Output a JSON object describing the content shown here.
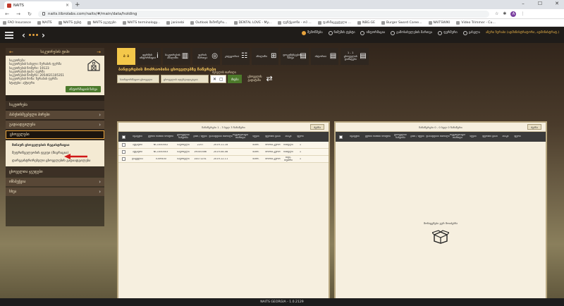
{
  "browser": {
    "tab_title": "NAITS",
    "url": "naits.tibrolabs.com/naits/#/main/data/holding",
    "bookmarks": [
      "FAO Insurance",
      "NAITS",
      "NAITS ტესტ",
      "NAITS ჯგუფები",
      "NAITS terminology...",
      "janinebi",
      "Outlook მიმოწერა...",
      "DENTAL LOVE - My...",
      "ფუნქციონი - ოპ ...",
      "ფარმაცევტული ...",
      "NBG.GE",
      "Burger Sword Caree...",
      "NAITSWIKI",
      "Video Trimmer - Cu..."
    ],
    "profile_initial": "A"
  },
  "topnav": {
    "items": [
      "შემოწმება",
      "ნიმუშის ტესტი",
      "ინფორმაცია",
      "გამოსახულების მართვა",
      "ფერმერი",
      "გასვლა"
    ],
    "user": "აზერი ზურაბი (ადმინისტრატორი, ადმინისტრატ.)",
    "languages": [
      "KA",
      "EN"
    ]
  },
  "left": {
    "header": "საკუთრების ტიპი",
    "farm_lines": [
      "საკუთრება:",
      "საკუთრების სახელი: ზურაბის ფერმა",
      "საკუთრების ნომერი: 19123",
      "საკუთრების ტიპი: ფერმა",
      "საკუთრების ნომერი: 2054021105351",
      "საკუთრების ზონა: ზურაბის ფერმა",
      "სტატუსი: აქტიური"
    ],
    "farm_button": "ინფორმაციის ნახვა",
    "menu": [
      {
        "label": "საკუთრება",
        "arrow": "",
        "style": "dark"
      },
      {
        "label": "პასუხისმგებელი პირები",
        "arrow": "›",
        "style": "light"
      },
      {
        "label": "გადაადგილება",
        "arrow": "›",
        "style": "light"
      },
      {
        "label": "ცხოველები",
        "arrow": "",
        "style": "active"
      }
    ],
    "submenu": [
      "შინაურ ცხოველების რეგისტრაცია",
      "მეფრინველეობის ჯგუფი (მიგრაცია)",
      "დარეგისტრირებული ცხოველების გადაადგილება"
    ],
    "menu2": [
      {
        "label": "ცხოველთა ჯგუფები",
        "arrow": "",
        "style": "dark"
      },
      {
        "label": "ინსპექცია",
        "arrow": "›",
        "style": "light"
      },
      {
        "label": "სხვა",
        "arrow": "›",
        "style": "light"
      }
    ]
  },
  "toolbar": {
    "first": "ა ა",
    "buttons": [
      {
        "label": "ფერმის ინფორმაცია",
        "icon": "i"
      },
      {
        "label": "საკუთრების ანალიზი",
        "icon": "▥"
      },
      {
        "label": "ფარის მართვა",
        "icon": "◎"
      },
      {
        "label": "კატეგორია",
        "icon": "☷"
      },
      {
        "label": "ანალიზი",
        "icon": "⊞"
      },
      {
        "label": "დოკუმენტების ნახვა",
        "icon": "▤"
      },
      {
        "label": "ისტორია",
        "icon": "▤"
      },
      {
        "label": "1 - 1 ცხოველის დამატება",
        "icon": "▤"
      }
    ]
  },
  "page": {
    "title": "ბანდერების მოძრაობისა ცხოველებზე ჩაწერები",
    "filter1": "საინფორმაციო ცხოველი",
    "filter2": "ცხოველის იდენტიფიკაცია",
    "date_label": "შესვლის თარიღი",
    "search_label": "ძიება",
    "move_label": "ცხოველის გადატანა"
  },
  "grid_left": {
    "caption": "ჩანაწერები 1 - 3 სულ 3 ჩანაწერი",
    "button": "ძებნა",
    "columns": [
      "სტატუსი",
      "ყურის ნიშნის ნომერი",
      "ცხოველის სახეობა",
      "ჯიში / სქესი",
      "დაბადების თარიღი",
      "რეგისტრაციის თარიღი",
      "სქესი",
      "ფერმის ტიპი",
      "ასაკი",
      "ფერი"
    ],
    "rows": [
      [
        "აქტიური",
        "NC1000002",
        "საქონელი",
        "2257",
        "2019-11-18",
        "მამრ.",
        "ძროხა-კურო",
        "წითელი",
        "1"
      ],
      [
        "აქტიური",
        "NC1000003",
        "საქონელი",
        "19005386",
        "2019-08-08",
        "მამრ.",
        "ძროხა-კურო",
        "წითელი",
        "1"
      ],
      [
        "დაცულია",
        "TU09400",
        "საქონელი",
        "14471251",
        "2019-12-11",
        "მამრ.",
        "ძროხა-კურო",
        "შავი-თეთრი",
        "1"
      ]
    ]
  },
  "grid_right": {
    "caption": "ჩანაწერები 0 - 0 სულ 0 ჩანაწერი",
    "button": "ძებნა",
    "columns": [
      "სტატუსი",
      "ყურის ნიშნის ნომერი",
      "ცხოველის სახეობა",
      "ჯიში / სქესი",
      "დაბადების თარიღი",
      "რეგისტრაციის თარიღი",
      "სქესი",
      "ფერმის ტიპი",
      "ასაკი",
      "ფერი"
    ],
    "empty": "მონაცემები ვერ მოიძებნა"
  },
  "footer": "NAITS GEORGIA - 1.0.2129"
}
